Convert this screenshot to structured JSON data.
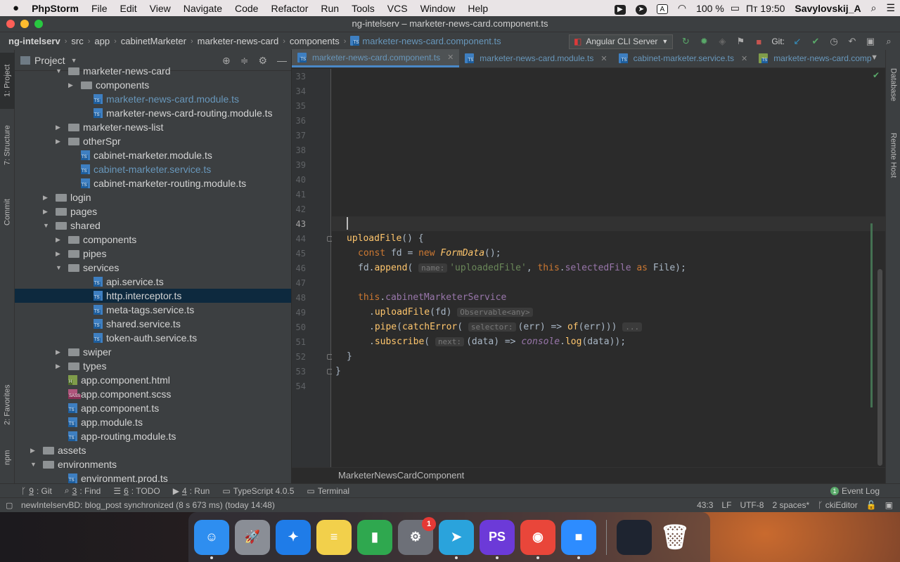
{
  "menubar": {
    "apple": "",
    "app": "PhpStorm",
    "items": [
      "File",
      "Edit",
      "View",
      "Navigate",
      "Code",
      "Refactor",
      "Run",
      "Tools",
      "VCS",
      "Window",
      "Help"
    ],
    "battery": "100 %",
    "clock": "Пт 19:50",
    "user": "Savylovskij_A",
    "input_lang": "A"
  },
  "window": {
    "title": "ng-intelserv – marketer-news-card.component.ts"
  },
  "navbar": {
    "crumbs": [
      "ng-intelserv",
      "src",
      "app",
      "cabinetMarketer",
      "marketer-news-card",
      "components",
      "marketer-news-card.component.ts"
    ],
    "run_config": "Angular CLI Server",
    "git_label": "Git:"
  },
  "lefttool": {
    "tabs": [
      "1: Project",
      "7: Structure",
      "Commit",
      "2: Favorites",
      "npm"
    ]
  },
  "righttool": {
    "tabs": [
      "Database",
      "Remote Host"
    ]
  },
  "project": {
    "title": "Project",
    "rows": [
      {
        "label": "marketer-news-card",
        "type": "folder",
        "indent": 3,
        "arrow": "down"
      },
      {
        "label": "components",
        "type": "folder",
        "indent": 4,
        "arrow": "right"
      },
      {
        "label": "marketer-news-card.module.ts",
        "type": "ts",
        "indent": 5,
        "mod": true
      },
      {
        "label": "marketer-news-card-routing.module.ts",
        "type": "ts",
        "indent": 5
      },
      {
        "label": "marketer-news-list",
        "type": "folder",
        "indent": 3,
        "arrow": "right"
      },
      {
        "label": "otherSpr",
        "type": "folder",
        "indent": 3,
        "arrow": "right"
      },
      {
        "label": "cabinet-marketer.module.ts",
        "type": "ts",
        "indent": 4
      },
      {
        "label": "cabinet-marketer.service.ts",
        "type": "ts",
        "indent": 4,
        "mod": true
      },
      {
        "label": "cabinet-marketer-routing.module.ts",
        "type": "ts",
        "indent": 4
      },
      {
        "label": "login",
        "type": "folder",
        "indent": 2,
        "arrow": "right"
      },
      {
        "label": "pages",
        "type": "folder",
        "indent": 2,
        "arrow": "right"
      },
      {
        "label": "shared",
        "type": "folder",
        "indent": 2,
        "arrow": "down"
      },
      {
        "label": "components",
        "type": "folder",
        "indent": 3,
        "arrow": "right"
      },
      {
        "label": "pipes",
        "type": "folder",
        "indent": 3,
        "arrow": "right"
      },
      {
        "label": "services",
        "type": "folder",
        "indent": 3,
        "arrow": "down"
      },
      {
        "label": "api.service.ts",
        "type": "ts",
        "indent": 5
      },
      {
        "label": "http.interceptor.ts",
        "type": "ts",
        "indent": 5,
        "selected": true
      },
      {
        "label": "meta-tags.service.ts",
        "type": "ts",
        "indent": 5
      },
      {
        "label": "shared.service.ts",
        "type": "ts",
        "indent": 5
      },
      {
        "label": "token-auth.service.ts",
        "type": "ts",
        "indent": 5
      },
      {
        "label": "swiper",
        "type": "folder",
        "indent": 3,
        "arrow": "right"
      },
      {
        "label": "types",
        "type": "folder",
        "indent": 3,
        "arrow": "right"
      },
      {
        "label": "app.component.html",
        "type": "html",
        "indent": 3
      },
      {
        "label": "app.component.scss",
        "type": "scss",
        "indent": 3
      },
      {
        "label": "app.component.ts",
        "type": "ts",
        "indent": 3
      },
      {
        "label": "app.module.ts",
        "type": "ts",
        "indent": 3
      },
      {
        "label": "app-routing.module.ts",
        "type": "ts",
        "indent": 3
      },
      {
        "label": "assets",
        "type": "folder",
        "indent": 1,
        "arrow": "right"
      },
      {
        "label": "environments",
        "type": "folder",
        "indent": 1,
        "arrow": "down"
      },
      {
        "label": "environment.prod.ts",
        "type": "ts",
        "indent": 3
      }
    ]
  },
  "tabs": [
    {
      "label": "marketer-news-card.component.ts",
      "active": true
    },
    {
      "label": "marketer-news-card.module.ts"
    },
    {
      "label": "cabinet-marketer.service.ts"
    },
    {
      "label": "marketer-news-card.comp"
    }
  ],
  "editor": {
    "line_numbers": [
      "33",
      "34",
      "35",
      "36",
      "37",
      "38",
      "39",
      "40",
      "41",
      "42",
      "43",
      "44",
      "45",
      "46",
      "47",
      "48",
      "49",
      "50",
      "51",
      "52",
      "53",
      "54"
    ],
    "code": {
      "l44_fn": "uploadFile",
      "l44_rest": "() {",
      "l45_kw1": "const",
      "l45_var": " fd = ",
      "l45_kw2": "new",
      "l45_cls": "FormData",
      "l45_end": "();",
      "l46_obj": "fd.",
      "l46_fn": "append",
      "l46_open": "(",
      "l46_hint": "name:",
      "l46_str": "'uploadedFile'",
      "l46_comma": ", ",
      "l46_this": "this",
      "l46_dot": ".",
      "l46_prop": "selectedFile",
      "l46_as": " as ",
      "l46_end": "File);",
      "l48_this": "this",
      "l48_dot": ".",
      "l48_prop": "cabinetMarketerService",
      "l49_dot": ".",
      "l49_fn": "uploadFile",
      "l49_args": "(fd)",
      "l49_hint": "Observable<any>",
      "l50_dot": ".",
      "l50_fn": "pipe",
      "l50_open": "(",
      "l50_fn2": "catchError",
      "l50_open2": "(",
      "l50_hint": "selector:",
      "l50_mid": "(err) => ",
      "l50_fn3": "of",
      "l50_end": "(err)))",
      "l50_hint2": "...",
      "l51_dot": ".",
      "l51_fn": "subscribe",
      "l51_open": "(",
      "l51_hint": "next:",
      "l51_mid": "(data) => ",
      "l51_obj": "console",
      "l51_dot2": ".",
      "l51_fn2": "log",
      "l51_end": "(data));",
      "l52": "}",
      "l53": "}"
    },
    "breadcrumb": "MarketerNewsCardComponent"
  },
  "bottom_toolbar": [
    {
      "num": "9",
      "label": ": Git"
    },
    {
      "num": "3",
      "label": ": Find"
    },
    {
      "num": "6",
      "label": ": TODO"
    },
    {
      "num": "4",
      "label": ": Run"
    },
    {
      "num": "",
      "label": "TypeScript 4.0.5"
    },
    {
      "num": "",
      "label": "Terminal"
    }
  ],
  "event_log": {
    "count": "1",
    "label": "Event Log"
  },
  "status": {
    "message": "newIntelservBD: blog_post synchronized (8 s 673 ms) (today 14:48)",
    "position": "43:3",
    "line_sep": "LF",
    "encoding": "UTF-8",
    "indent": "2 spaces*",
    "branch": "ckiEditor"
  },
  "dock": {
    "apps": [
      {
        "name": "Finder",
        "color": "#2e8ef0",
        "glyph": "☺",
        "running": true
      },
      {
        "name": "Launchpad",
        "color": "#8a8e96",
        "glyph": "🚀"
      },
      {
        "name": "Safari",
        "color": "#1f7ce8",
        "glyph": "✦"
      },
      {
        "name": "Notes",
        "color": "#f2d04b",
        "glyph": "≡"
      },
      {
        "name": "Numbers",
        "color": "#2fa84f",
        "glyph": "▮"
      },
      {
        "name": "System Preferences",
        "color": "#6d7078",
        "glyph": "⚙",
        "badge": "1"
      },
      {
        "name": "Telegram",
        "color": "#2aa3dc",
        "glyph": "➤",
        "running": true
      },
      {
        "name": "PhpStorm",
        "color": "#6c3ad8",
        "glyph": "PS",
        "running": true
      },
      {
        "name": "Chrome",
        "color": "#e9463a",
        "glyph": "◉",
        "running": true
      },
      {
        "name": "Zoom",
        "color": "#2d8cff",
        "glyph": "■",
        "running": true
      }
    ],
    "trash_glyph": "🗑"
  }
}
